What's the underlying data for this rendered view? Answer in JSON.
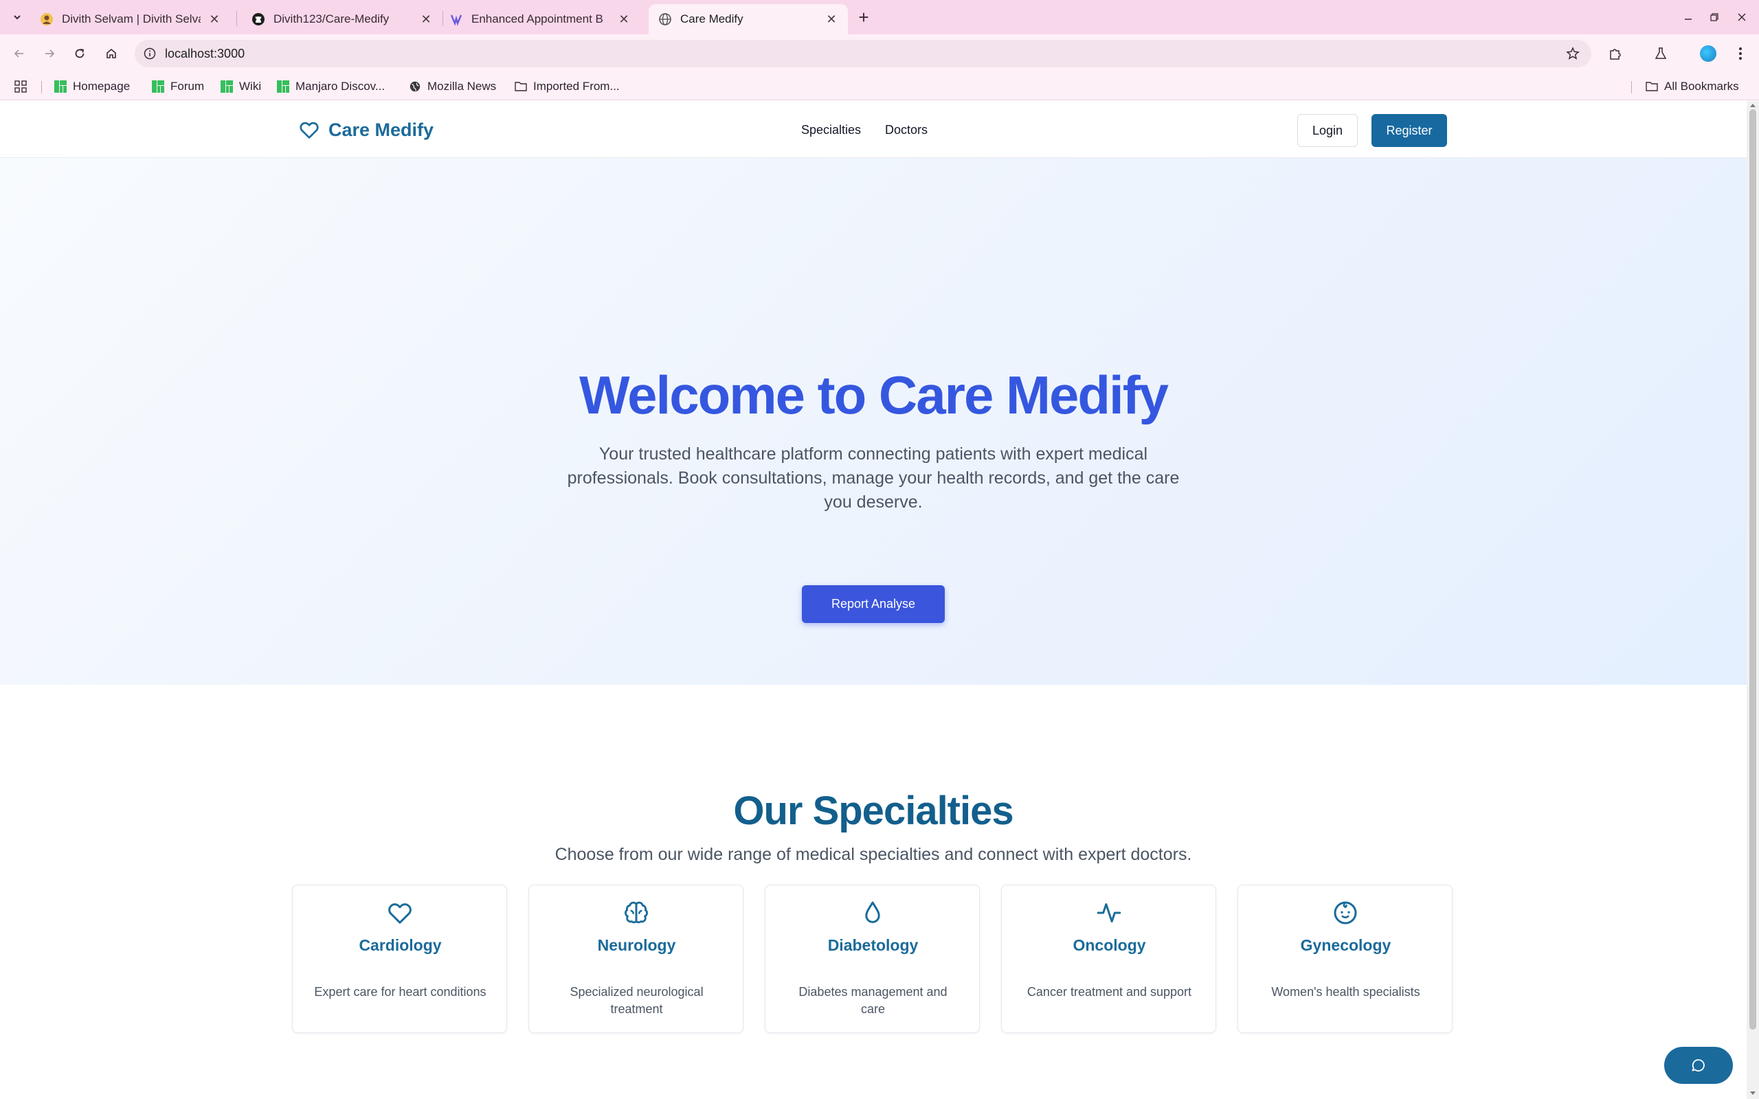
{
  "browser": {
    "tabs": [
      {
        "title": "Divith Selvam | Divith Selvam",
        "favicon": "avatar-favicon"
      },
      {
        "title": "Divith123/Care-Medify",
        "favicon": "github-icon"
      },
      {
        "title": "Enhanced Appointment B",
        "favicon": "app-favicon"
      },
      {
        "title": "Care Medify",
        "favicon": "globe-icon",
        "active": true
      }
    ],
    "url": "localhost:3000",
    "bookmarks": [
      {
        "label": "Homepage",
        "icon": "manjaro-icon"
      },
      {
        "label": "Forum",
        "icon": "manjaro-icon"
      },
      {
        "label": "Wiki",
        "icon": "manjaro-icon"
      },
      {
        "label": "Manjaro Discov...",
        "icon": "manjaro-icon"
      },
      {
        "label": "Mozilla News",
        "icon": "globe-icon"
      },
      {
        "label": "Imported From...",
        "icon": "folder-icon"
      }
    ],
    "all_bookmarks": "All Bookmarks",
    "accent": "#f8d7ea"
  },
  "site": {
    "brand": "Care Medify",
    "nav": [
      "Specialties",
      "Doctors"
    ],
    "login": "Login",
    "register": "Register",
    "primary_color": "#1769a0"
  },
  "hero": {
    "title": "Welcome to Care Medify",
    "lead": "Your trusted healthcare platform connecting patients with expert medical professionals. Book consultations, manage your health records, and get the care you deserve.",
    "cta": "Report Analyse"
  },
  "specialties": {
    "title": "Our Specialties",
    "subtitle": "Choose from our wide range of medical specialties and connect with expert doctors.",
    "items": [
      {
        "name": "Cardiology",
        "desc": "Expert care for heart conditions",
        "icon": "heart-icon"
      },
      {
        "name": "Neurology",
        "desc": "Specialized neurological treatment",
        "icon": "brain-icon"
      },
      {
        "name": "Diabetology",
        "desc": "Diabetes management and care",
        "icon": "droplet-icon"
      },
      {
        "name": "Oncology",
        "desc": "Cancer treatment and support",
        "icon": "activity-icon"
      },
      {
        "name": "Gynecology",
        "desc": "Women's health specialists",
        "icon": "baby-icon"
      }
    ]
  },
  "chat": {
    "icon": "chat-icon"
  }
}
